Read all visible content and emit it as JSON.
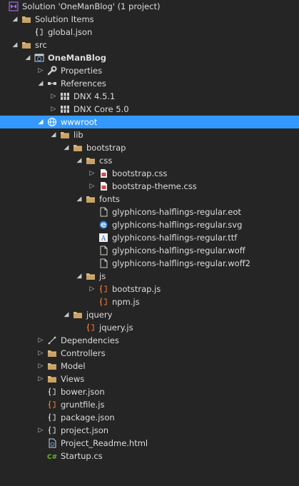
{
  "solution_explorer": {
    "items": [
      {
        "label": "Solution 'OneManBlog' (1 project)",
        "level": 0,
        "expander": "none",
        "icon": "solution-icon"
      },
      {
        "label": "Solution Items",
        "level": 1,
        "expander": "expanded",
        "icon": "folder-icon"
      },
      {
        "label": "global.json",
        "level": 2,
        "expander": "none",
        "icon": "json-file-icon"
      },
      {
        "label": "src",
        "level": 1,
        "expander": "expanded",
        "icon": "folder-icon"
      },
      {
        "label": "OneManBlog",
        "level": 2,
        "expander": "expanded",
        "icon": "web-project-icon",
        "bold": true
      },
      {
        "label": "Properties",
        "level": 3,
        "expander": "collapsed",
        "icon": "wrench-icon"
      },
      {
        "label": "References",
        "level": 3,
        "expander": "expanded",
        "icon": "references-icon"
      },
      {
        "label": "DNX 4.5.1",
        "level": 4,
        "expander": "collapsed",
        "icon": "framework-icon"
      },
      {
        "label": "DNX Core 5.0",
        "level": 4,
        "expander": "collapsed",
        "icon": "framework-icon"
      },
      {
        "label": "wwwroot",
        "level": 3,
        "expander": "expanded",
        "icon": "globe-icon",
        "selected": true
      },
      {
        "label": "lib",
        "level": 4,
        "expander": "expanded",
        "icon": "folder-icon"
      },
      {
        "label": "bootstrap",
        "level": 5,
        "expander": "expanded",
        "icon": "folder-icon"
      },
      {
        "label": "css",
        "level": 6,
        "expander": "expanded",
        "icon": "folder-icon"
      },
      {
        "label": "bootstrap.css",
        "level": 7,
        "expander": "collapsed",
        "icon": "css-file-icon"
      },
      {
        "label": "bootstrap-theme.css",
        "level": 7,
        "expander": "collapsed",
        "icon": "css-file-icon"
      },
      {
        "label": "fonts",
        "level": 6,
        "expander": "expanded",
        "icon": "folder-icon"
      },
      {
        "label": "glyphicons-halflings-regular.eot",
        "level": 7,
        "expander": "none",
        "icon": "file-icon"
      },
      {
        "label": "glyphicons-halflings-regular.svg",
        "level": 7,
        "expander": "none",
        "icon": "svg-file-icon"
      },
      {
        "label": "glyphicons-halflings-regular.ttf",
        "level": 7,
        "expander": "none",
        "icon": "font-file-icon"
      },
      {
        "label": "glyphicons-halflings-regular.woff",
        "level": 7,
        "expander": "none",
        "icon": "file-icon"
      },
      {
        "label": "glyphicons-halflings-regular.woff2",
        "level": 7,
        "expander": "none",
        "icon": "file-icon"
      },
      {
        "label": "js",
        "level": 6,
        "expander": "expanded",
        "icon": "folder-icon"
      },
      {
        "label": "bootstrap.js",
        "level": 7,
        "expander": "collapsed",
        "icon": "js-file-icon"
      },
      {
        "label": "npm.js",
        "level": 7,
        "expander": "none",
        "icon": "js-file-icon"
      },
      {
        "label": "jquery",
        "level": 5,
        "expander": "expanded",
        "icon": "folder-icon"
      },
      {
        "label": "jquery.js",
        "level": 6,
        "expander": "none",
        "icon": "js-file-icon"
      },
      {
        "label": "Dependencies",
        "level": 3,
        "expander": "collapsed",
        "icon": "dependencies-icon"
      },
      {
        "label": "Controllers",
        "level": 3,
        "expander": "collapsed",
        "icon": "folder-icon"
      },
      {
        "label": "Model",
        "level": 3,
        "expander": "collapsed",
        "icon": "folder-icon"
      },
      {
        "label": "Views",
        "level": 3,
        "expander": "collapsed",
        "icon": "folder-icon"
      },
      {
        "label": "bower.json",
        "level": 3,
        "expander": "none",
        "icon": "json-file-icon"
      },
      {
        "label": "gruntfile.js",
        "level": 3,
        "expander": "none",
        "icon": "js-file-icon"
      },
      {
        "label": "package.json",
        "level": 3,
        "expander": "none",
        "icon": "json-file-icon"
      },
      {
        "label": "project.json",
        "level": 3,
        "expander": "collapsed",
        "icon": "json-file-icon"
      },
      {
        "label": "Project_Readme.html",
        "level": 3,
        "expander": "none",
        "icon": "html-file-icon"
      },
      {
        "label": "Startup.cs",
        "level": 3,
        "expander": "none",
        "icon": "csharp-file-icon"
      }
    ]
  },
  "colors": {
    "background": "#252526",
    "selection": "#3399ff",
    "text": "#dcdcdc",
    "folder": "#dcb67a",
    "js": "#e8782d",
    "css": "#cf4b4b",
    "csharp": "#68b723"
  }
}
